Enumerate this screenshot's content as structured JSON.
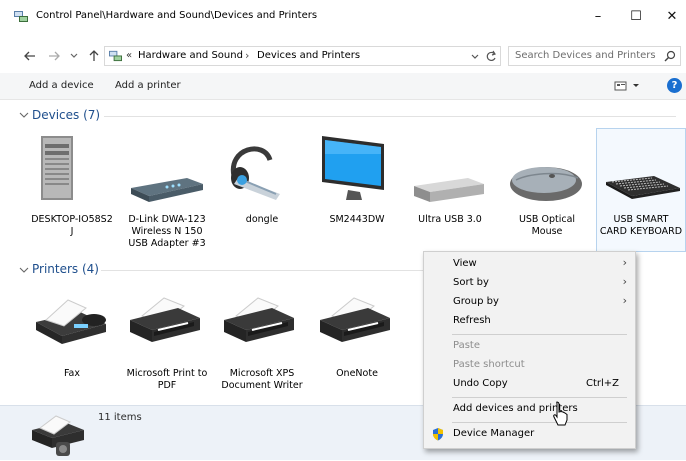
{
  "window": {
    "title": "Control Panel\\Hardware and Sound\\Devices and Printers",
    "minimize_glyph": "–",
    "maximize_glyph": "☐",
    "close_glyph": "✕"
  },
  "address": {
    "overflow": "«",
    "crumbs": [
      "Hardware and Sound",
      "Devices and Printers"
    ],
    "separator": "›",
    "search_placeholder": "Search Devices and Printers"
  },
  "commands": {
    "add_device": "Add a device",
    "add_printer": "Add a printer",
    "help_glyph": "?"
  },
  "devices_group": {
    "header": "Devices (7)",
    "items": [
      {
        "label": "DESKTOP-IO58S2 J",
        "icon": "computer-tower-icon"
      },
      {
        "label": "D-Link DWA-123 Wireless N 150 USB Adapter #3",
        "icon": "usb-adapter-icon"
      },
      {
        "label": "dongle",
        "icon": "headset-icon"
      },
      {
        "label": "SM2443DW",
        "icon": "monitor-icon"
      },
      {
        "label": "Ultra USB 3.0",
        "icon": "external-drive-icon"
      },
      {
        "label": "USB Optical Mouse",
        "icon": "mouse-icon"
      },
      {
        "label": "USB SMART CARD KEYBOARD",
        "icon": "keyboard-icon"
      }
    ]
  },
  "printers_group": {
    "header": "Printers (4)",
    "items": [
      {
        "label": "Fax",
        "icon": "fax-icon"
      },
      {
        "label": "Microsoft Print to PDF",
        "icon": "printer-icon"
      },
      {
        "label": "Microsoft XPS Document Writer",
        "icon": "printer-icon"
      },
      {
        "label": "OneNote",
        "icon": "printer-icon"
      }
    ]
  },
  "status": {
    "count": "11 items"
  },
  "context_menu": {
    "view": "View",
    "sort_by": "Sort by",
    "group_by": "Group by",
    "refresh": "Refresh",
    "paste": "Paste",
    "paste_shortcut": "Paste shortcut",
    "undo_copy": "Undo Copy",
    "undo_shortcut": "Ctrl+Z",
    "add_devices": "Add devices and printers",
    "device_manager": "Device Manager",
    "chevron": "›"
  },
  "colors": {
    "accent": "#1e4e8c",
    "status_bg": "#edf2f8",
    "menu_bg": "#f2f2f2"
  }
}
